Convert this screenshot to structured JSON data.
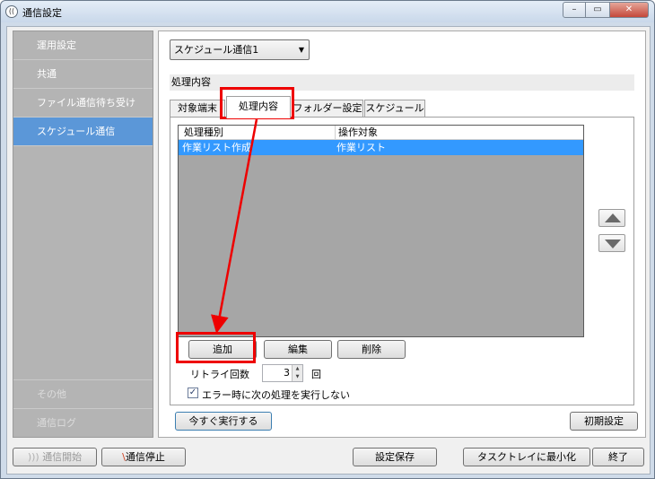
{
  "window": {
    "title": "通信設定",
    "icon": "radio-wave-icon",
    "controls": {
      "minimize": "–",
      "maximize": "▭",
      "close": "✕"
    }
  },
  "sidebar": {
    "items": [
      {
        "label": "運用設定",
        "state": "normal"
      },
      {
        "label": "共通",
        "state": "normal"
      },
      {
        "label": "ファイル通信待ち受け",
        "state": "normal"
      },
      {
        "label": "スケジュール通信",
        "state": "selected"
      }
    ],
    "bottom_items": [
      {
        "label": "その他",
        "state": "disabled"
      },
      {
        "label": "通信ログ",
        "state": "disabled"
      }
    ]
  },
  "main": {
    "schedule_select": {
      "value": "スケジュール通信1",
      "caret": "▼"
    },
    "section_title": "処理内容",
    "tabs": [
      {
        "label": "対象端末",
        "active": false
      },
      {
        "label": "処理内容",
        "active": true
      },
      {
        "label": "フォルダー設定",
        "active": false
      },
      {
        "label": "スケジュール",
        "active": false
      }
    ],
    "list": {
      "columns": [
        "処理種別",
        "操作対象"
      ],
      "rows": [
        {
          "type": "作業リスト作成",
          "target": "作業リスト",
          "selected": true
        }
      ]
    },
    "move_up_icon": "triangle-up-icon",
    "move_down_icon": "triangle-down-icon",
    "buttons": {
      "add": "追加",
      "edit": "編集",
      "delete": "削除"
    },
    "retry": {
      "label": "リトライ回数",
      "value": "3",
      "unit": "回",
      "up": "▲",
      "down": "▼"
    },
    "continue_on_error": {
      "label": "エラー時に次の処理を実行しない",
      "checked": true,
      "mark": "✓"
    },
    "run_now_label": "今すぐ実行する",
    "reset_label": "初期設定"
  },
  "footer": {
    "start": {
      "icon": "))) ",
      "label": "通信開始",
      "enabled": false
    },
    "stop": {
      "icon": "\\",
      "label": "通信停止",
      "enabled": true
    },
    "save": "設定保存",
    "minimize_to_tray": "タスクトレイに最小化",
    "exit": "終了"
  },
  "annotations": {
    "color": "#ee0000",
    "highlights": [
      "tab-processing",
      "add-button"
    ]
  }
}
